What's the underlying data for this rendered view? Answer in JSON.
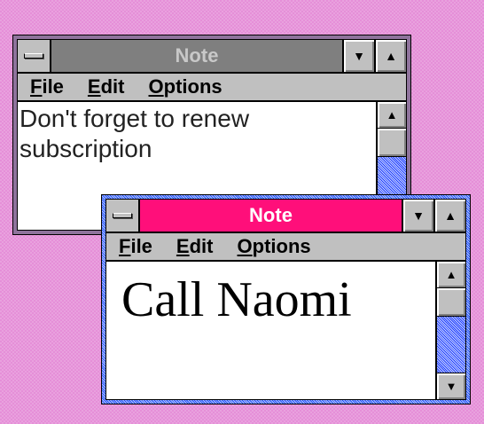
{
  "windows": [
    {
      "title": "Note",
      "active": false,
      "menu": [
        "File",
        "Edit",
        "Options"
      ],
      "content": "Don't forget to renew\nsubscription",
      "controls": {
        "system": "system-menu-icon",
        "minimize": "down-arrow-icon",
        "maximize": "up-arrow-icon"
      }
    },
    {
      "title": "Note",
      "active": true,
      "menu": [
        "File",
        "Edit",
        "Options"
      ],
      "content": "Call Naomi",
      "controls": {
        "system": "system-menu-icon",
        "minimize": "down-arrow-icon",
        "maximize": "up-arrow-icon"
      }
    }
  ],
  "colors": {
    "desktop": "#e58fd8",
    "active_title": "#ff0f7a",
    "inactive_title": "#7f7f7f",
    "scrollbar": "#2040ff",
    "chrome": "#c0c0c0"
  }
}
